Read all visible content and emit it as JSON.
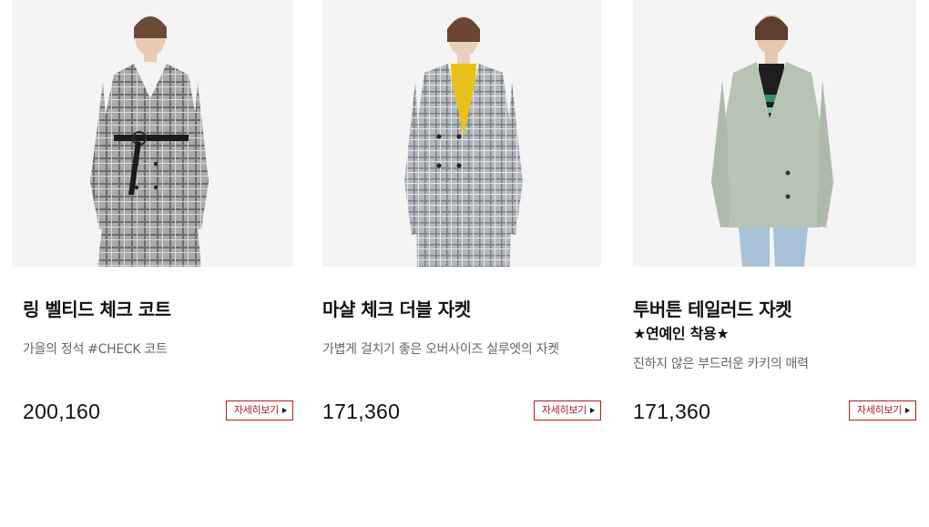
{
  "products": [
    {
      "title": "링 벨티드 체크 코트",
      "description": "가을의 정석 #CHECK 코트",
      "price": "200,160",
      "detail_label": "자세히보기"
    },
    {
      "title": "마샬 체크 더블 자켓",
      "description": "가볍게 걸치기 좋은 오버사이즈 실루엣의 자켓",
      "price": "171,360",
      "detail_label": "자세히보기"
    },
    {
      "title": "투버튼 테일러드 자켓",
      "title_line2": "★연예인 착용★",
      "description": "진하지 않은 부드러운 카키의 매력",
      "price": "171,360",
      "detail_label": "자세히보기"
    }
  ],
  "colors": {
    "accent": "#b21b1b",
    "image_bg": "#f4f4f4",
    "description": "#666666"
  },
  "icons": [
    "arrow-right-icon"
  ]
}
